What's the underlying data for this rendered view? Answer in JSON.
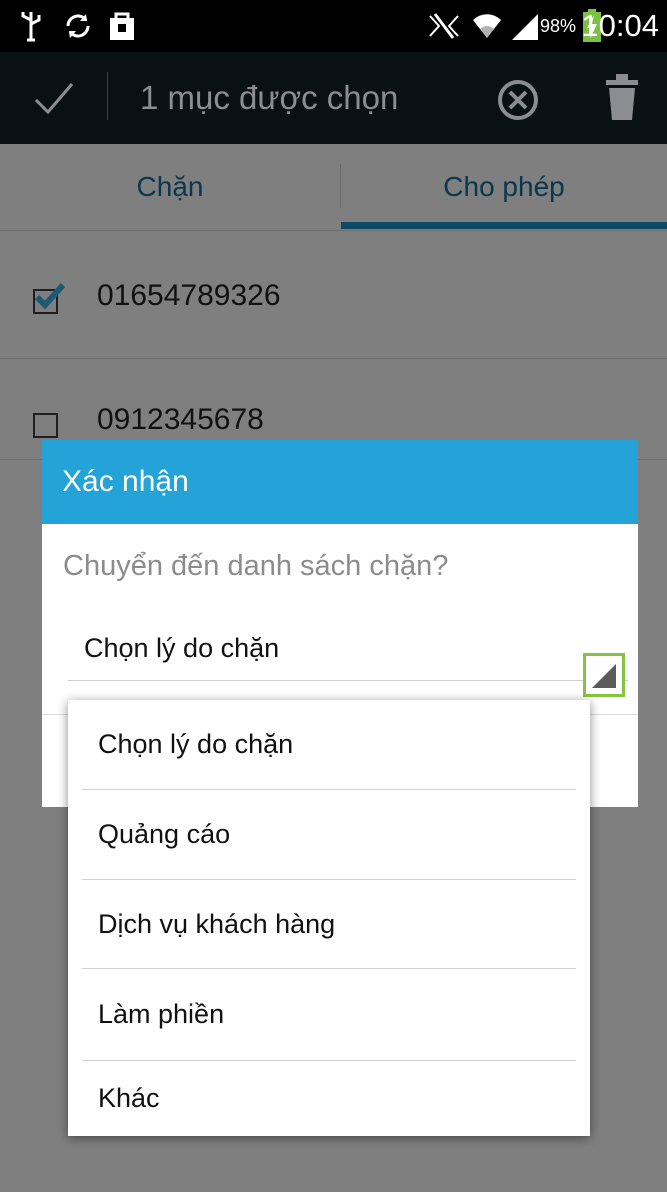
{
  "status_bar": {
    "time": "10:04",
    "battery_percent": "98%",
    "icons": [
      "usb-icon",
      "sync-icon",
      "shopping-bag-icon",
      "no-sim-icon",
      "wifi-icon",
      "signal-icon",
      "battery-charging-icon"
    ]
  },
  "action_bar": {
    "title": "1 mục được chọn"
  },
  "tabs": [
    {
      "label": "Chặn",
      "selected": false
    },
    {
      "label": "Cho phép",
      "selected": true
    }
  ],
  "list": [
    {
      "number": "01654789326",
      "checked": true
    },
    {
      "number": "0912345678",
      "checked": false
    }
  ],
  "dialog": {
    "title": "Xác nhận",
    "question": "Chuyển đến danh sách chặn?",
    "spinner_value": "Chọn lý do chặn"
  },
  "dropdown": {
    "options": [
      "Chọn lý do chặn",
      "Quảng cáo",
      "Dịch vụ khách hàng",
      "Làm phiền",
      "Khác"
    ]
  },
  "colors": {
    "dialog_header": "#23a3d7",
    "highlight": "#86c440",
    "battery_bolt": "#7bc043"
  }
}
